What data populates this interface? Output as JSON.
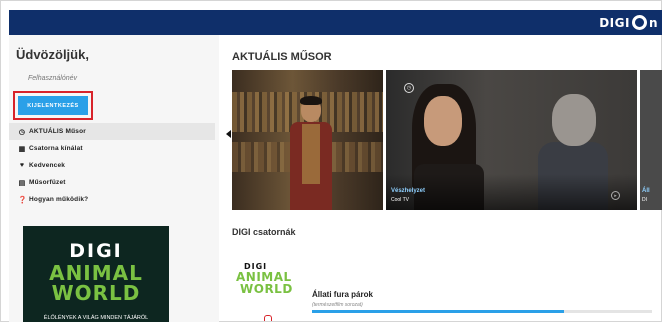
{
  "header": {
    "brand_text": "DIGI",
    "brand_suffix": "n"
  },
  "sidebar": {
    "welcome": "Üdvözöljük,",
    "username": "Felhasználónév",
    "logout_label": "KIJELENTKEZÉS",
    "items": [
      {
        "label": "AKTUÁLIS Műsor",
        "icon": "clock-icon",
        "glyph": "◷",
        "active": true
      },
      {
        "label": "Csatorna kínálat",
        "icon": "grid-icon",
        "glyph": "▦",
        "active": false
      },
      {
        "label": "Kedvencek",
        "icon": "heart-icon",
        "glyph": "♥",
        "active": false
      },
      {
        "label": "Műsorfüzet",
        "icon": "list-icon",
        "glyph": "▤",
        "active": false
      },
      {
        "label": "Hogyan működik?",
        "icon": "question-icon",
        "glyph": "❓",
        "active": false
      }
    ],
    "promo": {
      "brand": "DIGI",
      "line1": "ANIMAL",
      "line2": "WORLD",
      "tagline": "ÉLŐLÉNYEK A VILÁG MINDEN TÁJÁRÓL"
    }
  },
  "main": {
    "now_title": "AKTUÁLIS MŰSOR",
    "carousel": [
      {
        "title": "",
        "channel": ""
      },
      {
        "title": "Vészhelyzet",
        "channel": "Cool TV"
      },
      {
        "title": "Áll",
        "channel": "DI"
      }
    ],
    "channels_title": "DIGI csatornák",
    "channel_logo": {
      "brand": "DIGI",
      "line1": "ANIMAL",
      "line2": "WORLD"
    },
    "program": {
      "title": "Állati fura párok",
      "genre": "(természetfilm sorozat)",
      "progress": 0.74
    }
  },
  "colors": {
    "header_bg": "#0f2f6a",
    "accent": "#2aa0e8",
    "highlight_border": "#d8232a",
    "brand_green": "#7ac142"
  }
}
